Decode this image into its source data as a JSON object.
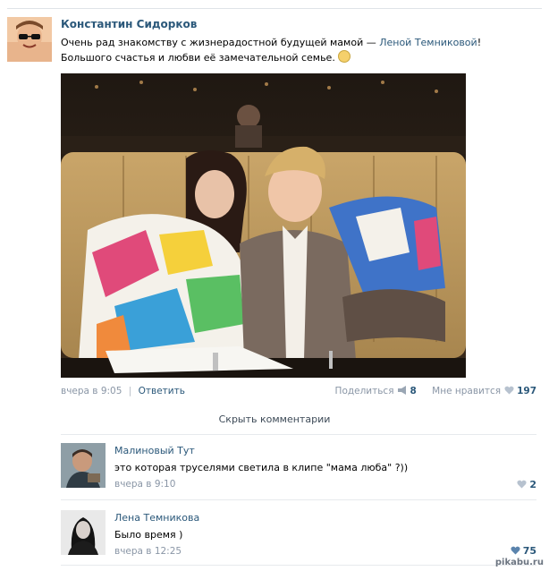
{
  "post": {
    "author": "Константин Сидорков",
    "text_before": "Очень рад знакомству с жизнерадостной будущей мамой — ",
    "mention": "Леной Темниковой",
    "text_after": "! Большого счастья и любви её замечательной семье.",
    "date": "вчера в 9:05",
    "reply_label": "Ответить",
    "share_label": "Поделиться",
    "share_count": "8",
    "like_label": "Мне нравится",
    "like_count": "197"
  },
  "hide_comments_label": "Скрыть комментарии",
  "comments": [
    {
      "author": "Малиновый Тут",
      "text": "это которая труселями светила в клипе \"мама люба\" ?))",
      "date": "вчера в 9:10",
      "likes": "2"
    },
    {
      "author": "Лена Темникова",
      "text": "Было время )",
      "date": "вчера в 12:25",
      "likes": "75"
    }
  ],
  "watermark": "pikabu.ru",
  "colors": {
    "link": "#2b587a",
    "muted": "#8a96a6",
    "divider": "#e7eaed"
  },
  "icons": [
    "heart-icon",
    "megaphone-icon",
    "apple-icon",
    "smile-emoji-icon"
  ]
}
